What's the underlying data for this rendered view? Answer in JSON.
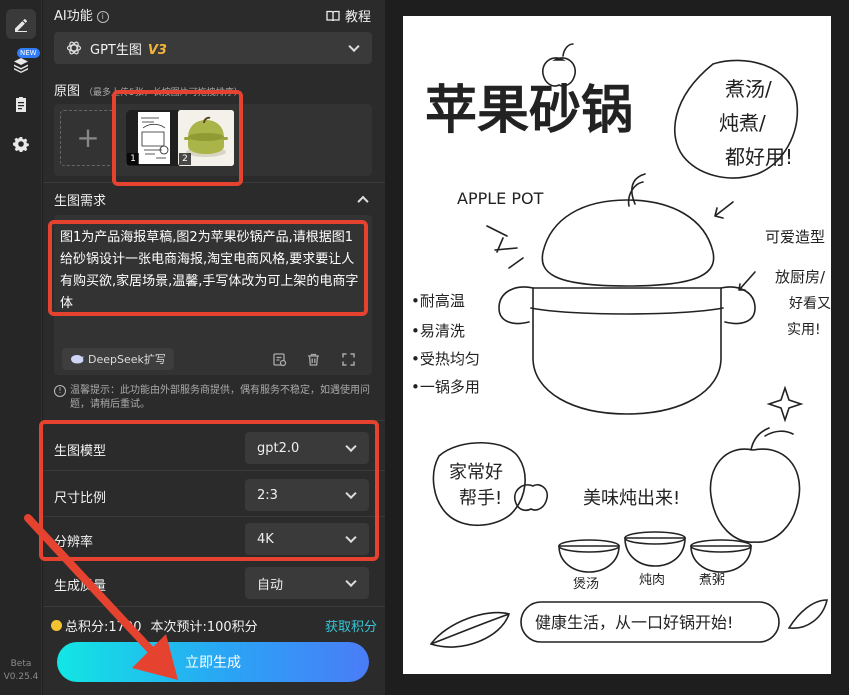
{
  "rail": {
    "new_badge": "NEW",
    "version_line1": "Beta",
    "version_line2": "V0.25.4"
  },
  "header": {
    "title": "AI功能",
    "tutorial": "教程"
  },
  "model_select": {
    "label": "GPT生图",
    "version": "V3"
  },
  "source_images": {
    "title": "原图",
    "hint": "（最多上传5张，长按图片可拖拽排序）",
    "thumbs": [
      {
        "index": "1"
      },
      {
        "index": "2"
      }
    ]
  },
  "prompt_section": {
    "title": "生图需求",
    "text": "图1为产品海报草稿,图2为苹果砂锅产品,请根据图1给砂锅设计一张电商海报,淘宝电商风格,要求要让人有购买欲,家居场景,温馨,手写体改为可上架的电商字体",
    "deepseek_button": "DeepSeek扩写"
  },
  "warning": "温馨提示：此功能由外部服务商提供，偶有服务不稳定，如遇使用问题，请稍后重试。",
  "params": [
    {
      "label": "生图模型",
      "value": "gpt2.0"
    },
    {
      "label": "尺寸比例",
      "value": "2:3"
    },
    {
      "label": "分辨率",
      "value": "4K"
    },
    {
      "label": "生成质量",
      "value": "自动"
    }
  ],
  "footer": {
    "points_text": "总积分:1700",
    "estimate_text": "本次预计:100积分",
    "get_points": "获取积分",
    "generate_button": "立即生成"
  },
  "poster": {
    "title": "苹果砂锅",
    "subtitle": "APPLE POT",
    "bubble_lines": [
      "煮汤/",
      "炖煮/",
      "都好用!"
    ],
    "cute_note": [
      "可爱造型",
      "放厨房/",
      "好看又",
      "实用!"
    ],
    "features": [
      "•耐高温",
      "•易清洗",
      "•受热均匀",
      "•一锅多用"
    ],
    "helper_bubble": [
      "家常好",
      "帮手!"
    ],
    "tasty_line": "美味炖出来!",
    "bowl_labels": [
      "煲汤",
      "炖肉",
      "煮粥"
    ],
    "slogan": "健康生活，从一口好锅开始!"
  },
  "colors": {
    "accent_red": "#e5432f",
    "gold": "#f0b43a",
    "link": "#37c5d8",
    "button_from": "#12e6e3",
    "button_to": "#4a7cf7"
  }
}
